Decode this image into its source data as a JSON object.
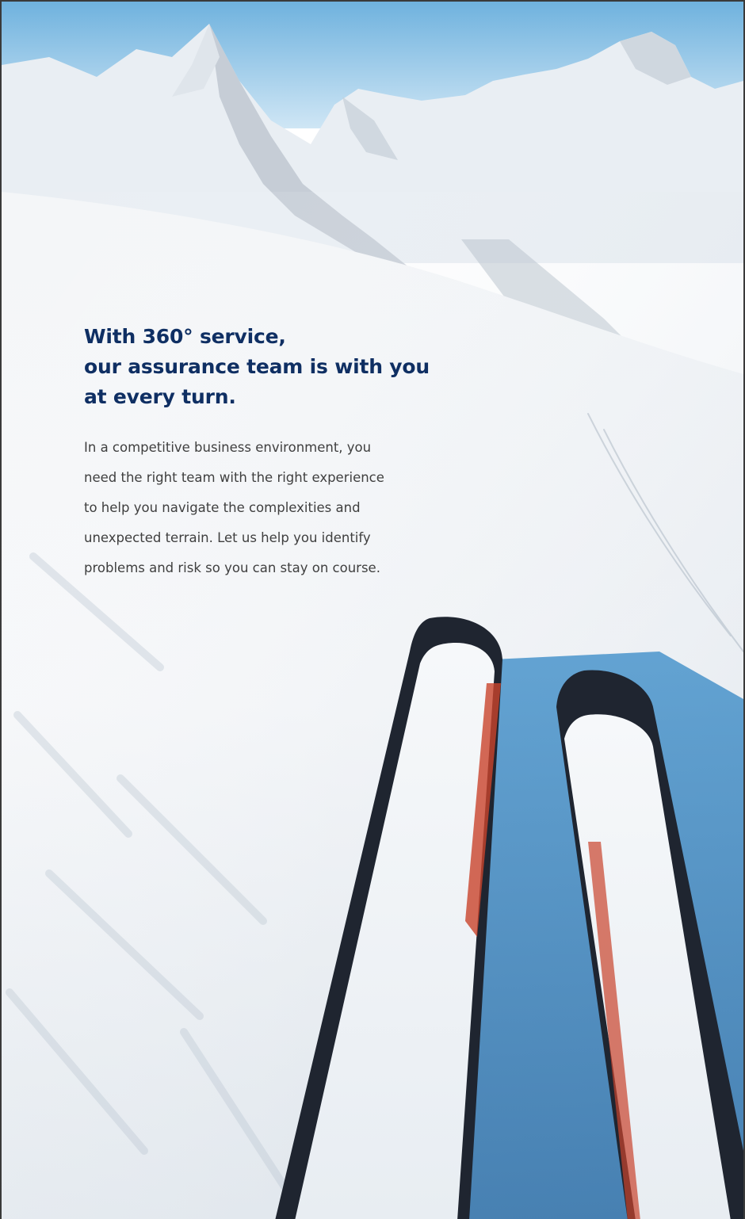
{
  "headline": {
    "line1": "With 360° service,",
    "line2": "our assurance team is with you",
    "line3": "at every turn."
  },
  "body": {
    "line1": "In a competitive business environment, you",
    "line2": "need the right team with the right experience",
    "line3": "to help you navigate the complexities and",
    "line4": "unexpected terrain. Let us help you identify",
    "line5": "problems and risk so you can stay on course."
  },
  "colors": {
    "headline": "#0f2f63",
    "body_text": "#3f3f3f",
    "sky": "#9cc9e8",
    "ski_base": "#1f2530",
    "shadow": "#3f8ac4"
  },
  "image": {
    "subject": "first-person view of skis speeding down a snowy slope toward alpine peaks"
  }
}
